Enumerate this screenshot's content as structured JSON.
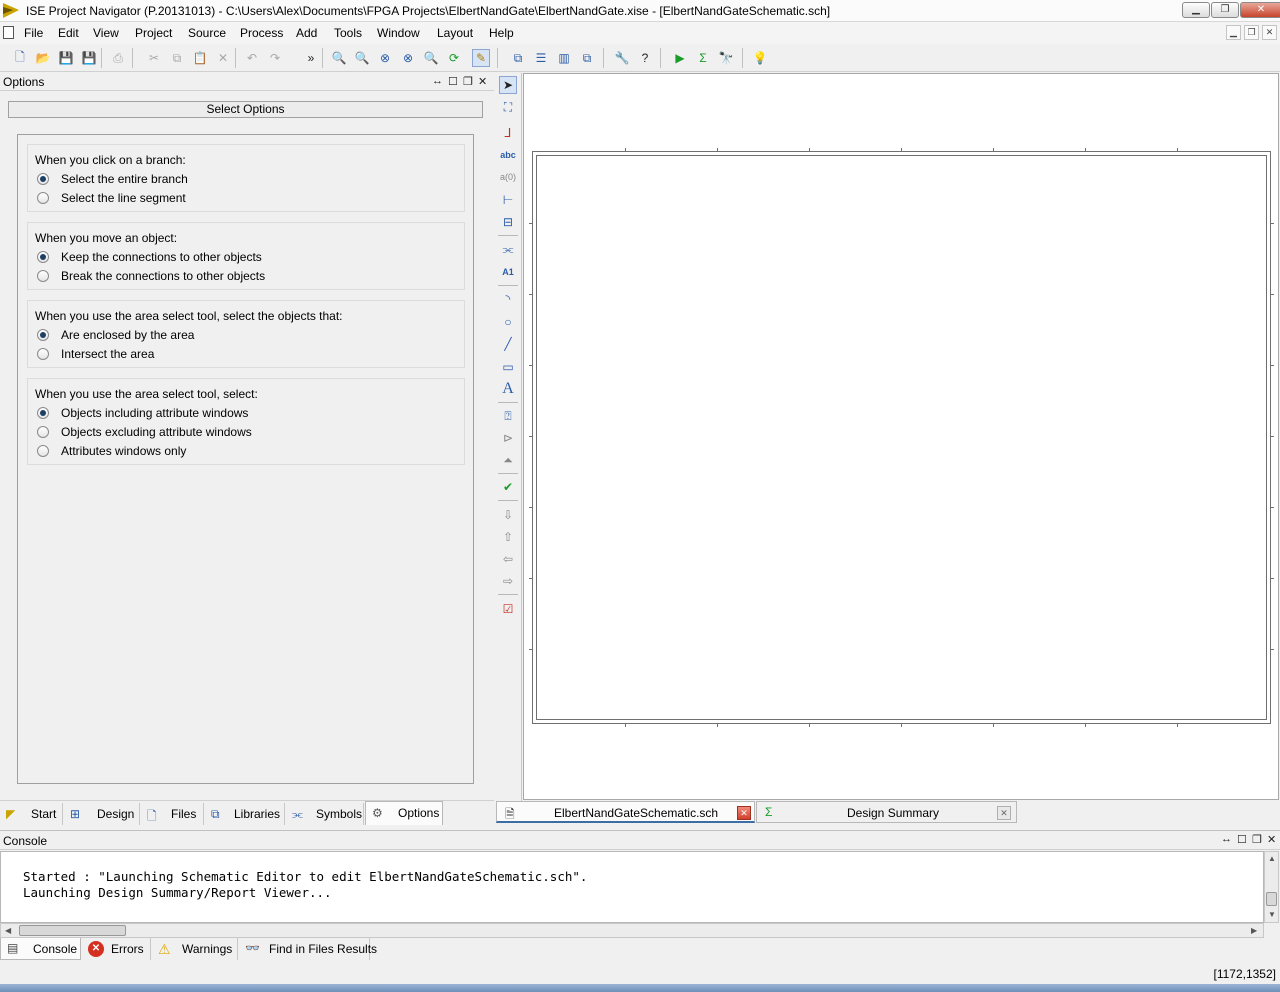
{
  "window": {
    "title": "ISE Project Navigator (P.20131013) - C:\\Users\\Alex\\Documents\\FPGA Projects\\ElbertNandGate\\ElbertNandGate.xise - [ElbertNandGateSchematic.sch]",
    "minimize_label": "▁",
    "maximize_label": "❐",
    "close_label": "✕"
  },
  "menu": {
    "items": [
      "File",
      "Edit",
      "View",
      "Project",
      "Source",
      "Process",
      "Add",
      "Tools",
      "Window",
      "Layout",
      "Help"
    ]
  },
  "options_panel": {
    "title": "Options",
    "select_options_label": "Select Options",
    "groups": [
      {
        "question": "When you click on a branch:",
        "options": [
          {
            "label": "Select the entire branch",
            "checked": true
          },
          {
            "label": "Select the line segment",
            "checked": false
          }
        ]
      },
      {
        "question": "When you move an object:",
        "options": [
          {
            "label": "Keep the connections to other objects",
            "checked": true
          },
          {
            "label": "Break the connections to other objects",
            "checked": false
          }
        ]
      },
      {
        "question": "When you use the area select tool, select the objects that:",
        "options": [
          {
            "label": "Are enclosed by the area",
            "checked": true
          },
          {
            "label": "Intersect the area",
            "checked": false
          }
        ]
      },
      {
        "question": "When you use the area select tool, select:",
        "options": [
          {
            "label": "Objects including attribute windows",
            "checked": true
          },
          {
            "label": "Objects excluding attribute windows",
            "checked": false
          },
          {
            "label": "Attributes windows only",
            "checked": false
          }
        ]
      }
    ]
  },
  "left_tabs": [
    "Start",
    "Design",
    "Files",
    "Libraries",
    "Symbols",
    "Options"
  ],
  "doc_tabs": [
    "ElbertNandGateSchematic.sch",
    "Design Summary"
  ],
  "console": {
    "title": "Console",
    "lines": [
      "Started : \"Launching Schematic Editor to edit ElbertNandGateSchematic.sch\".",
      "Launching Design Summary/Report Viewer..."
    ]
  },
  "console_tabs": [
    "Console",
    "Errors",
    "Warnings",
    "Find in Files Results"
  ],
  "status": {
    "coords": "[1172,1352]"
  },
  "colors": {
    "accent": "#3a6ea5",
    "error": "#d42f1f",
    "warning": "#e0a800",
    "run": "#1a9c2a"
  }
}
